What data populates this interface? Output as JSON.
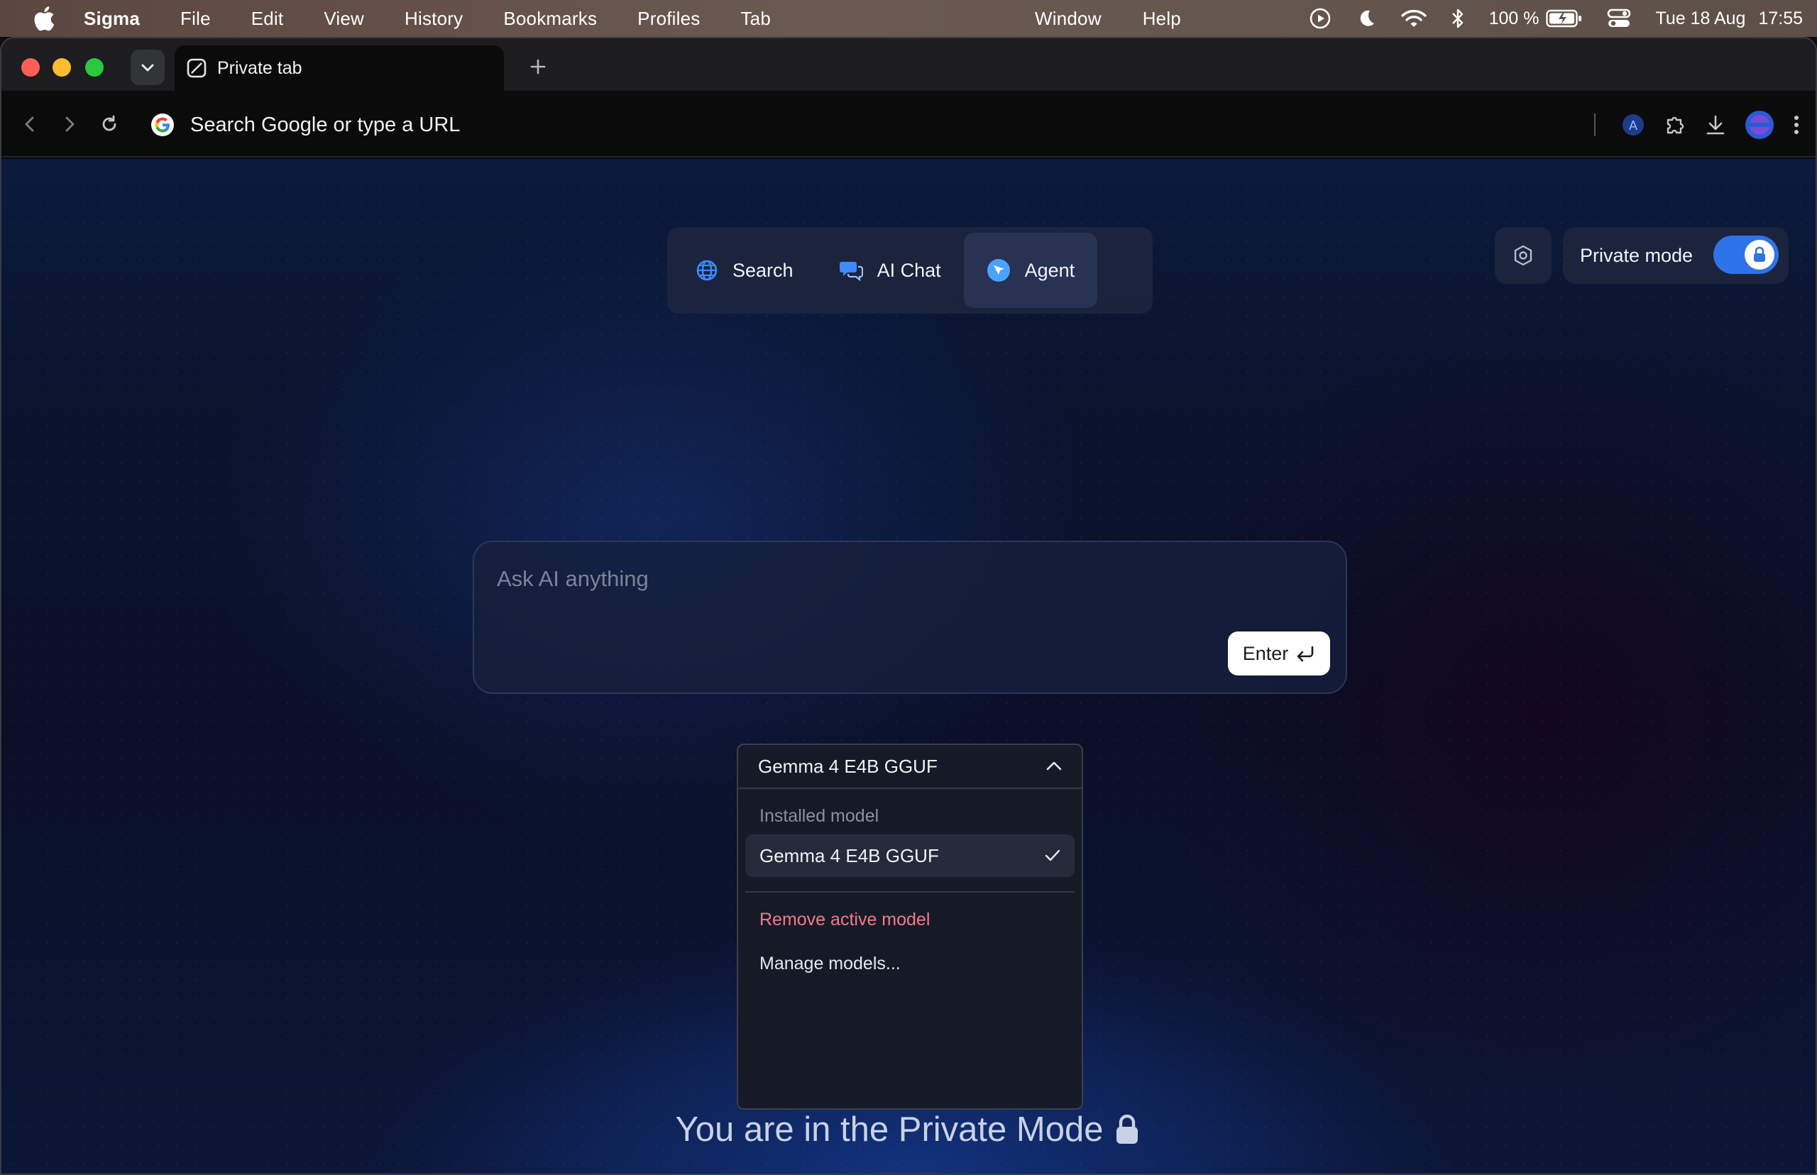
{
  "menubar": {
    "app_name": "Sigma",
    "items": [
      "File",
      "Edit",
      "View",
      "History",
      "Bookmarks",
      "Profiles",
      "Tab"
    ],
    "right_items": [
      "Window",
      "Help"
    ],
    "battery": "100 %",
    "date": "Tue 18 Aug",
    "time": "17:55"
  },
  "browser": {
    "tab_title": "Private tab",
    "omnibox_placeholder": "Search Google or type a URL",
    "profile_letter": "A"
  },
  "modes": [
    {
      "label": "Search",
      "icon": "globe-icon"
    },
    {
      "label": "AI Chat",
      "icon": "chat-bubbles-icon"
    },
    {
      "label": "Agent",
      "icon": "agent-cursor-icon",
      "active": true
    }
  ],
  "private_mode": {
    "label": "Private mode",
    "enabled": true
  },
  "prompt": {
    "placeholder": "Ask AI anything",
    "enter_label": "Enter"
  },
  "model_dropdown": {
    "selected": "Gemma 4 E4B GGUF",
    "section_label": "Installed model",
    "options": [
      {
        "label": "Gemma 4 E4B GGUF",
        "checked": true
      }
    ],
    "remove_label": "Remove active model",
    "manage_label": "Manage models..."
  },
  "footer_note": "You are in the Private Mode",
  "colors": {
    "accent": "#2f73e8",
    "danger": "#f27a8a",
    "page_bg": "#0a1430"
  }
}
